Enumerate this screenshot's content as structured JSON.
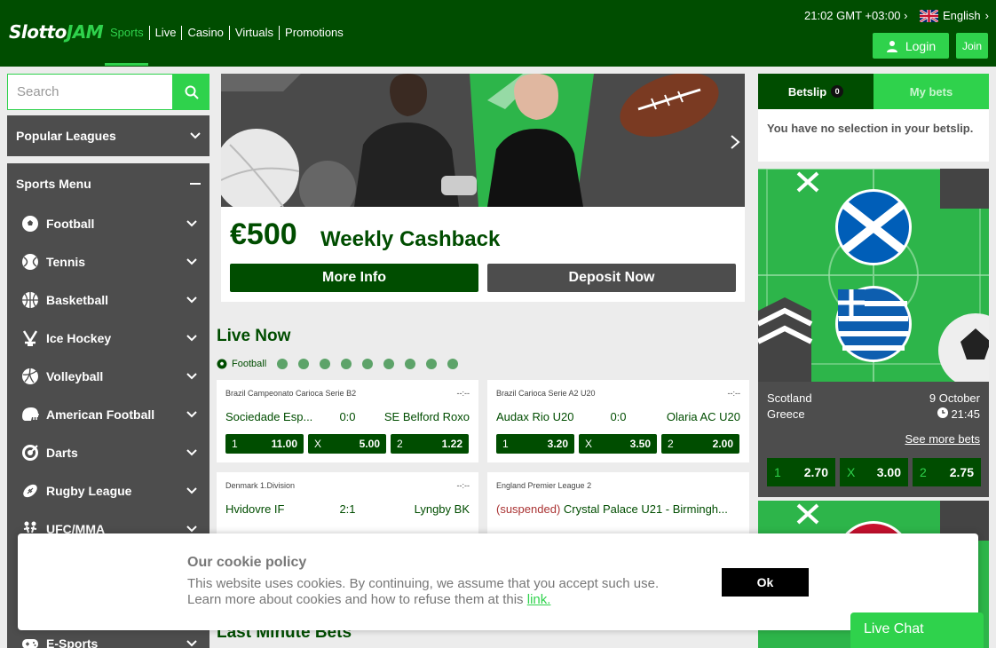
{
  "header": {
    "logo_part1": "Slotto",
    "logo_part2": "JAM",
    "nav": [
      "Sports",
      "Live",
      "Casino",
      "Virtuals",
      "Promotions"
    ],
    "time": "21:02 GMT +03:00",
    "language": "English",
    "login_label": "Login",
    "join_label": "Join"
  },
  "search": {
    "placeholder": "Search"
  },
  "popular_leagues": {
    "title": "Popular Leagues"
  },
  "sports_menu": {
    "title": "Sports Menu",
    "items": [
      "Football",
      "Tennis",
      "Basketball",
      "Ice Hockey",
      "Volleyball",
      "American Football",
      "Darts",
      "Rugby League",
      "UFC/MMA",
      "E-Sports"
    ]
  },
  "banner": {
    "amount": "€500",
    "text": "Weekly Cashback",
    "more_info": "More Info",
    "deposit": "Deposit Now"
  },
  "live": {
    "title": "Live Now",
    "filter_label": "Football",
    "matches": [
      {
        "league": "Brazil Campeonato Carioca Serie B2",
        "time": "--:--",
        "home": "Sociedade Esp...",
        "score": "0:0",
        "away": "SE Belford Roxo",
        "odds": [
          [
            "1",
            "11.00"
          ],
          [
            "X",
            "5.00"
          ],
          [
            "2",
            "1.22"
          ]
        ]
      },
      {
        "league": "Brazil Carioca Serie A2 U20",
        "time": "--:--",
        "home": "Audax Rio U20",
        "score": "0:0",
        "away": "Olaria AC U20",
        "odds": [
          [
            "1",
            "3.20"
          ],
          [
            "X",
            "3.50"
          ],
          [
            "2",
            "2.00"
          ]
        ]
      },
      {
        "league": "Denmark 1.Division",
        "time": "--:--",
        "home": "Hvidovre IF",
        "score": "2:1",
        "away": "Lyngby BK"
      },
      {
        "league": "England Premier League 2",
        "time": "",
        "suspended": "(suspended)",
        "title": "Crystal Palace U21 - Birmingh..."
      }
    ]
  },
  "last_minute": {
    "title": "Last Minute Bets"
  },
  "betslip": {
    "tab1": "Betslip",
    "count": "0",
    "tab2": "My bets",
    "empty": "You have no selection in your betslip."
  },
  "featured": {
    "team1": "Scotland",
    "team2": "Greece",
    "date": "9 October",
    "time": "21:45",
    "see_more": "See more bets",
    "odds": [
      [
        "1",
        "2.70"
      ],
      [
        "X",
        "3.00"
      ],
      [
        "2",
        "2.75"
      ]
    ]
  },
  "cookie": {
    "title": "Our cookie policy",
    "line1": "This website uses cookies. By continuing, we assume that you accept such use.",
    "line2": "Learn more about cookies and how to refuse them at this",
    "link": "link.",
    "ok": "Ok"
  },
  "live_chat": "Live Chat",
  "colors": {
    "dark_green": "#004d00",
    "bright_green": "#2fd24c",
    "panel_grey": "#4d4d4d"
  }
}
